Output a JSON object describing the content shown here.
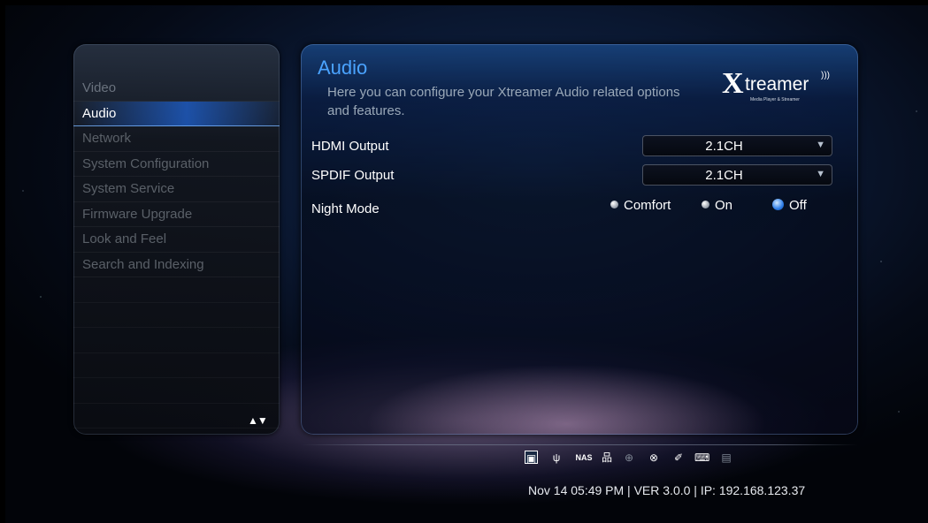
{
  "menu": {
    "items": [
      {
        "label": "Video"
      },
      {
        "label": "Audio"
      },
      {
        "label": "Network"
      },
      {
        "label": "System Configuration"
      },
      {
        "label": "System Service"
      },
      {
        "label": "Firmware Upgrade"
      },
      {
        "label": "Look and Feel"
      },
      {
        "label": "Search and Indexing"
      }
    ],
    "scroll_arrows": "▲▼"
  },
  "content": {
    "title": "Audio",
    "description": "Here you can configure your Xtreamer Audio related options and features.",
    "brand": {
      "x": "X",
      "name": "treamer",
      "tagline": "Media Player & Streamer"
    },
    "settings": {
      "hdmi": {
        "label": "HDMI Output",
        "value": "2.1CH"
      },
      "spdif": {
        "label": "SPDIF Output",
        "value": "2.1CH"
      },
      "night_mode": {
        "label": "Night Mode",
        "options": [
          "Comfort",
          "On",
          "Off"
        ],
        "selected": "Off"
      }
    }
  },
  "status": {
    "icons": [
      "picture-icon",
      "usb-icon",
      "nas-icon",
      "network-icon",
      "wifi-icon",
      "link-icon",
      "remote-icon",
      "keyboard-icon",
      "card-icon"
    ],
    "nas_label": "NAS",
    "line": "Nov 14 05:49 PM | VER 3.0.0 | IP: 192.168.123.37"
  }
}
